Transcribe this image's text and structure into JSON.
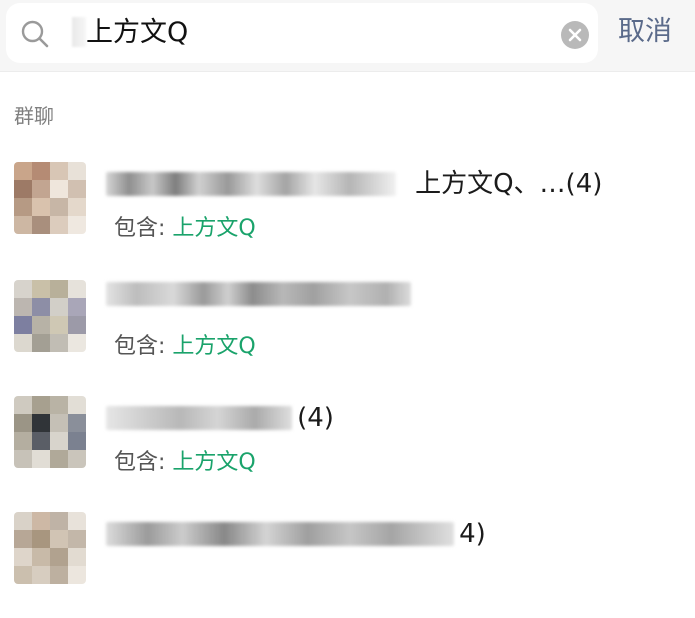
{
  "search": {
    "query": "上方文Q",
    "cancel_label": "取消"
  },
  "section": {
    "title": "群聊"
  },
  "results": [
    {
      "name_suffix": "上方文Q、…(4)",
      "contains_label": "包含: ",
      "contains_value": "上方文Q"
    },
    {
      "name_suffix": "",
      "contains_label": "包含: ",
      "contains_value": "上方文Q"
    },
    {
      "name_suffix": "(4)",
      "contains_label": "包含: ",
      "contains_value": "上方文Q"
    },
    {
      "name_suffix": "4)",
      "contains_label": "",
      "contains_value": ""
    }
  ],
  "colors": {
    "highlight": "#1aa36b",
    "cancel": "#5a6a8a"
  },
  "icons": {
    "search": "search-icon",
    "clear": "clear-icon"
  }
}
